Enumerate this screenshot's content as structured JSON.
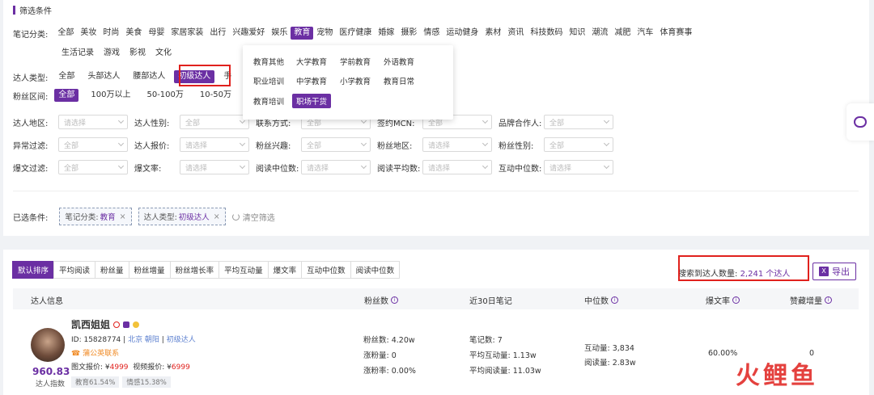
{
  "section_title": "筛选条件",
  "categories": {
    "label": "笔记分类:",
    "row1": [
      "全部",
      "美妆",
      "时尚",
      "美食",
      "母婴",
      "家居家装",
      "出行",
      "兴趣爱好",
      "娱乐",
      "教育",
      "宠物",
      "医疗健康",
      "婚嫁",
      "摄影",
      "情感",
      "运动健身",
      "素材",
      "资讯",
      "科技数码",
      "知识",
      "潮流",
      "减肥",
      "汽车",
      "体育赛事"
    ],
    "row2": [
      "生活记录",
      "游戏",
      "影视",
      "文化"
    ],
    "active": "教育"
  },
  "talent_type": {
    "label": "达人类型:",
    "options": [
      "全部",
      "头部达人",
      "腰部达人",
      "初级达人"
    ],
    "active": "初级达人",
    "overflow": "手"
  },
  "fans_range": {
    "label": "粉丝区间:",
    "options": [
      "全部",
      "100万以上",
      "50-100万",
      "10-50万"
    ],
    "active": "全部"
  },
  "dropdown": {
    "items": [
      "教育其他",
      "大学教育",
      "学前教育",
      "外语教育",
      "职业培训",
      "中学教育",
      "小学教育",
      "教育日常",
      "教育培训",
      "职场干货"
    ],
    "active": "职场干货"
  },
  "filters": [
    {
      "label": "达人地区:",
      "value": "请选择"
    },
    {
      "label": "达人性别:",
      "value": "全部"
    },
    {
      "label": "联系方式:",
      "value": "全部"
    },
    {
      "label": "签约MCN:",
      "value": "全部"
    },
    {
      "label": "品牌合作人:",
      "value": "全部"
    },
    {
      "label": "异常过滤:",
      "value": "全部"
    },
    {
      "label": "达人报价:",
      "value": "请选择"
    },
    {
      "label": "粉丝兴趣:",
      "value": "全部"
    },
    {
      "label": "粉丝地区:",
      "value": "请选择"
    },
    {
      "label": "粉丝性别:",
      "value": "全部"
    },
    {
      "label": "爆文过滤:",
      "value": "全部"
    },
    {
      "label": "爆文率:",
      "value": "请选择"
    },
    {
      "label": "阅读中位数:",
      "value": "请选择"
    },
    {
      "label": "阅读平均数:",
      "value": "请选择"
    },
    {
      "label": "互动中位数:",
      "value": "请选择"
    }
  ],
  "chosen": {
    "label": "已选条件:",
    "tags": [
      {
        "key": "笔记分类:",
        "value": "教育",
        "close": "×"
      },
      {
        "key": "达人类型:",
        "value": "初级达人",
        "close": "×"
      }
    ],
    "clear": "清空筛选"
  },
  "sort_tabs": [
    "默认排序",
    "平均阅读",
    "粉丝量",
    "粉丝增量",
    "粉丝增长率",
    "平均互动量",
    "爆文率",
    "互动中位数",
    "阅读中位数"
  ],
  "sort_active": "默认排序",
  "result": {
    "prefix": "搜索到达人数量:",
    "count": "2,241",
    "suffix": "个达人"
  },
  "export_label": "导出",
  "export_icon": "X",
  "table_headers": [
    "达人信息",
    "粉丝数",
    "近30日笔记",
    "中位数",
    "爆文率",
    "赞藏增量"
  ],
  "row": {
    "name": "凯西姐姐",
    "id": "ID: 15828774",
    "location": "北京 朝阳",
    "level": "初级达人",
    "contact": "☎ 蒲公英联系",
    "price_text": "图文报价: ¥",
    "price_text_val": "4999",
    "price_video": "视频报价: ¥",
    "price_video_val": "6999",
    "chips": [
      "教育61.54%",
      "情感15.38%"
    ],
    "index": "960.83",
    "index_label": "达人指数",
    "fans": "粉丝数: 4.20w",
    "fans_up": "涨粉量: 0",
    "fans_rate": "涨粉率: 0.00%",
    "notes": "笔记数: 7",
    "avg_interact": "平均互动量: 1.13w",
    "avg_read": "平均阅读量: 11.03w",
    "median_interact": "互动量: 3,834",
    "median_read": "阅读量: 2.83w",
    "viral_rate": "60.00%",
    "likes_up": "0"
  },
  "watermark": "火鲤鱼",
  "colors": {
    "accent": "#6b2fa3",
    "highlight": "#e0211d"
  }
}
